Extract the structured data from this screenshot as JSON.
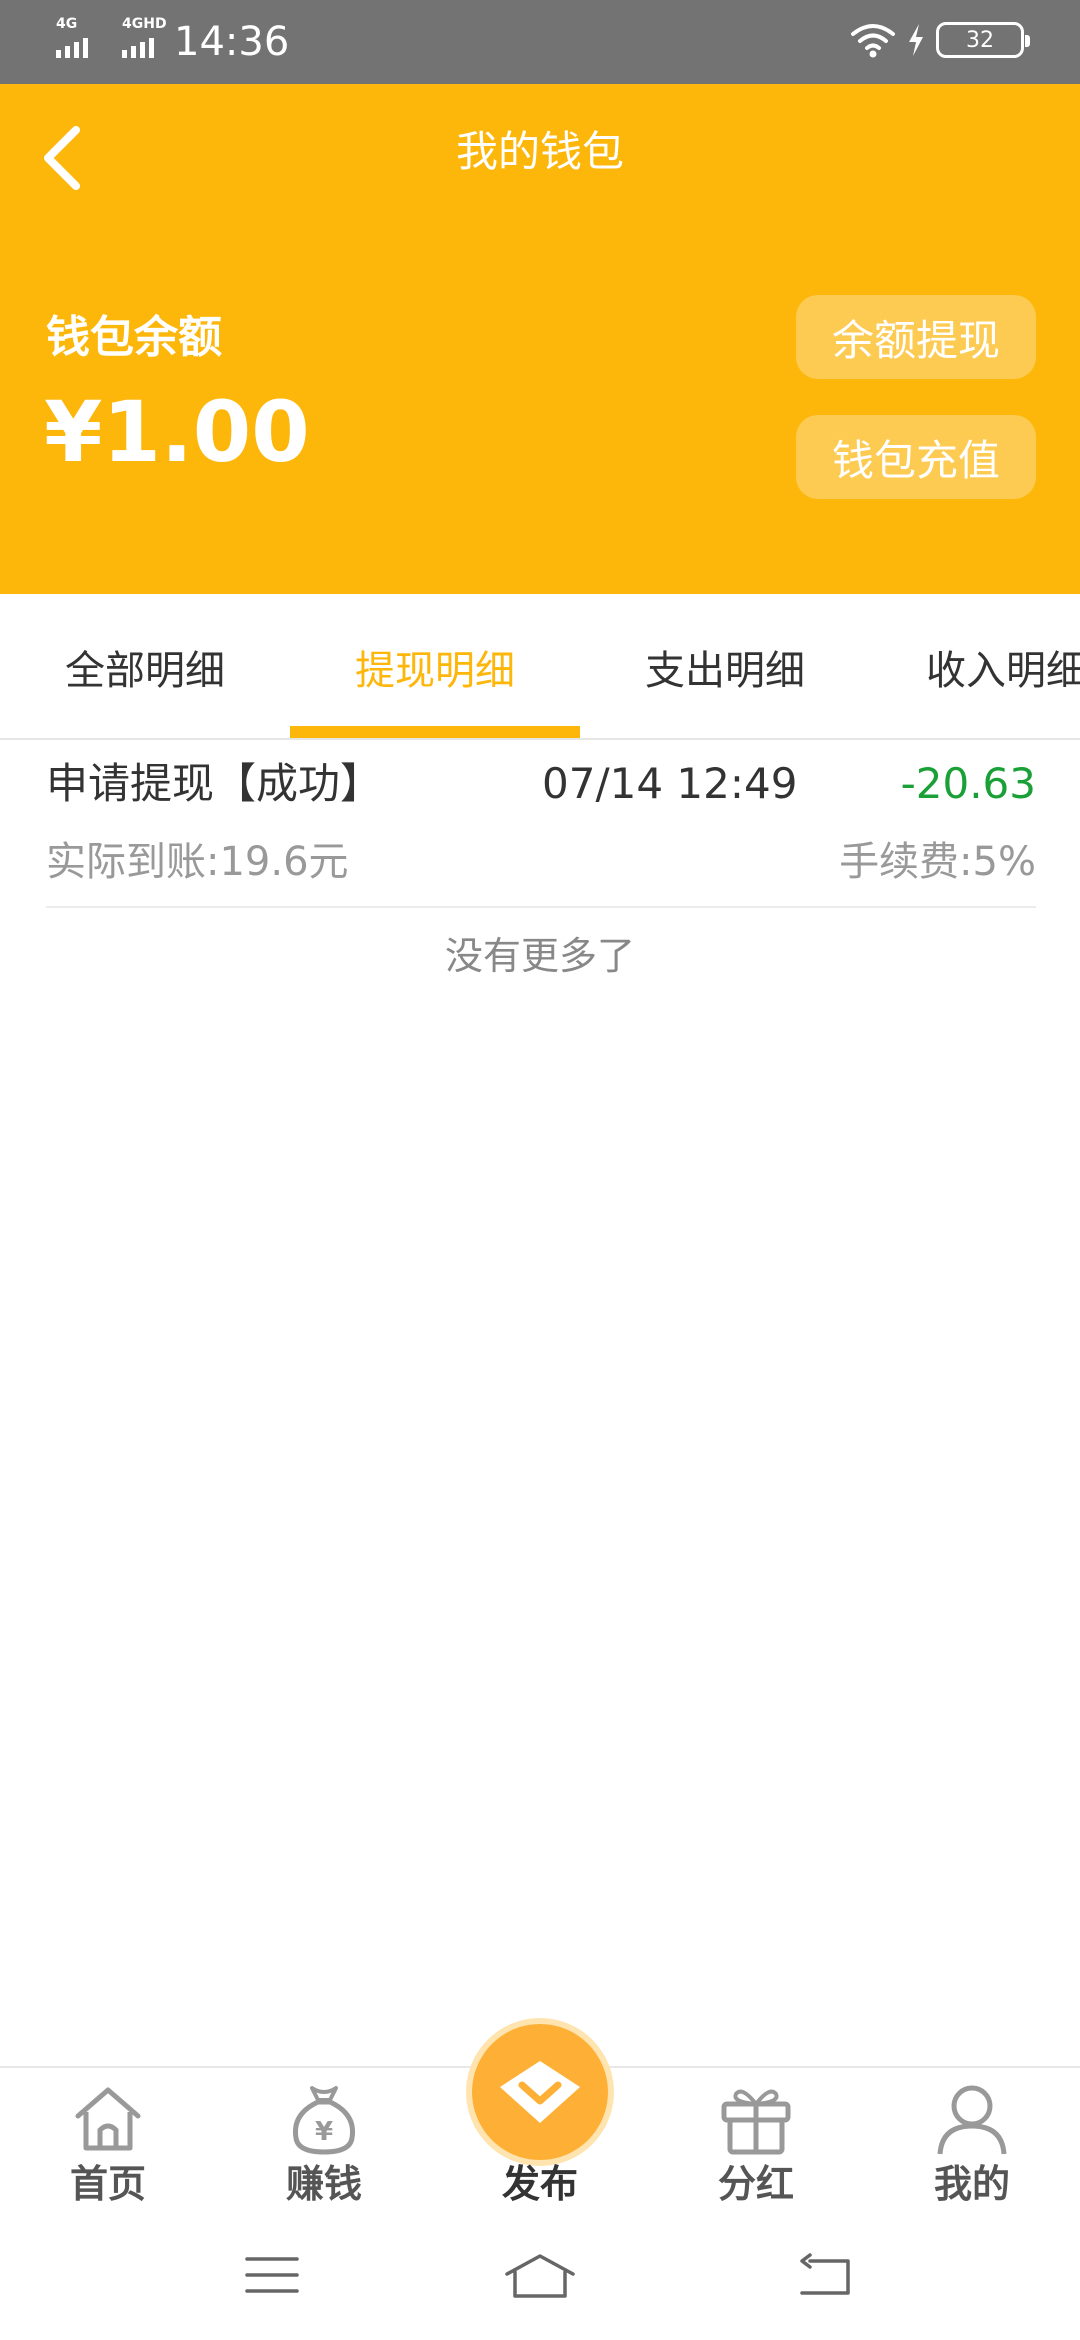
{
  "status_bar": {
    "signal1_label": "4G",
    "signal2_label": "4GHD",
    "time": "14:36",
    "battery": "32",
    "icons": [
      "signal-icon",
      "wifi-icon",
      "charging-icon",
      "battery-icon"
    ]
  },
  "header": {
    "title": "我的钱包",
    "balance_label": "钱包余额",
    "balance_amount": "¥1.00",
    "withdraw_label": "余额提现",
    "recharge_label": "钱包充值"
  },
  "tabs": [
    {
      "label": "全部明细",
      "active": false
    },
    {
      "label": "提现明细",
      "active": true
    },
    {
      "label": "支出明细",
      "active": false
    },
    {
      "label": "收入明细",
      "active": false
    }
  ],
  "records": [
    {
      "title": "申请提现【成功】",
      "time": "07/14 12:49",
      "amount": "-20.63",
      "actual": "实际到账:19.6元",
      "fee": "手续费:5%"
    }
  ],
  "no_more": "没有更多了",
  "bottom_nav": [
    {
      "label": "首页",
      "icon": "home-icon"
    },
    {
      "label": "赚钱",
      "icon": "money-bag-icon"
    },
    {
      "label": "发布",
      "icon": "publish-icon"
    },
    {
      "label": "分红",
      "icon": "gift-icon"
    },
    {
      "label": "我的",
      "icon": "user-icon"
    }
  ],
  "colors": {
    "brand": "#fdb60a",
    "amount_negative": "#1aa036",
    "status_bar": "#737373"
  }
}
